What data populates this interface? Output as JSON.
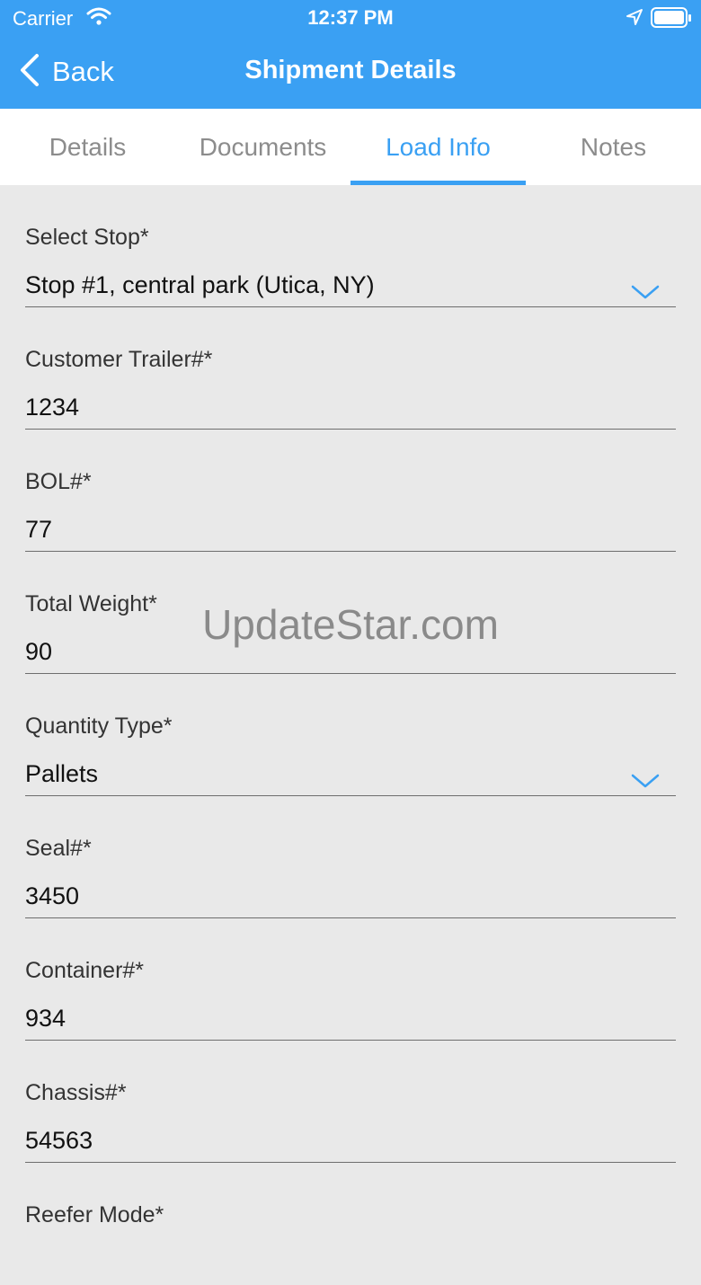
{
  "status_bar": {
    "carrier": "Carrier",
    "time": "12:37 PM"
  },
  "nav": {
    "back_label": "Back",
    "title": "Shipment Details"
  },
  "tabs": [
    {
      "label": "Details"
    },
    {
      "label": "Documents"
    },
    {
      "label": "Load Info",
      "active": true
    },
    {
      "label": "Notes"
    }
  ],
  "form": {
    "select_stop": {
      "label": "Select Stop*",
      "value": "Stop #1, central park (Utica, NY)"
    },
    "customer_trailer": {
      "label": "Customer Trailer#*",
      "value": "1234"
    },
    "bol": {
      "label": "BOL#*",
      "value": "77"
    },
    "total_weight": {
      "label": "Total Weight*",
      "value": "90"
    },
    "quantity_type": {
      "label": "Quantity Type*",
      "value": "Pallets"
    },
    "seal": {
      "label": "Seal#*",
      "value": "3450"
    },
    "container": {
      "label": "Container#*",
      "value": "934"
    },
    "chassis": {
      "label": "Chassis#*",
      "value": "54563"
    },
    "reefer_mode": {
      "label": "Reefer Mode*"
    }
  },
  "watermark": "UpdateStar.com",
  "colors": {
    "accent": "#3aa0f3",
    "background": "#e9e9e9"
  }
}
